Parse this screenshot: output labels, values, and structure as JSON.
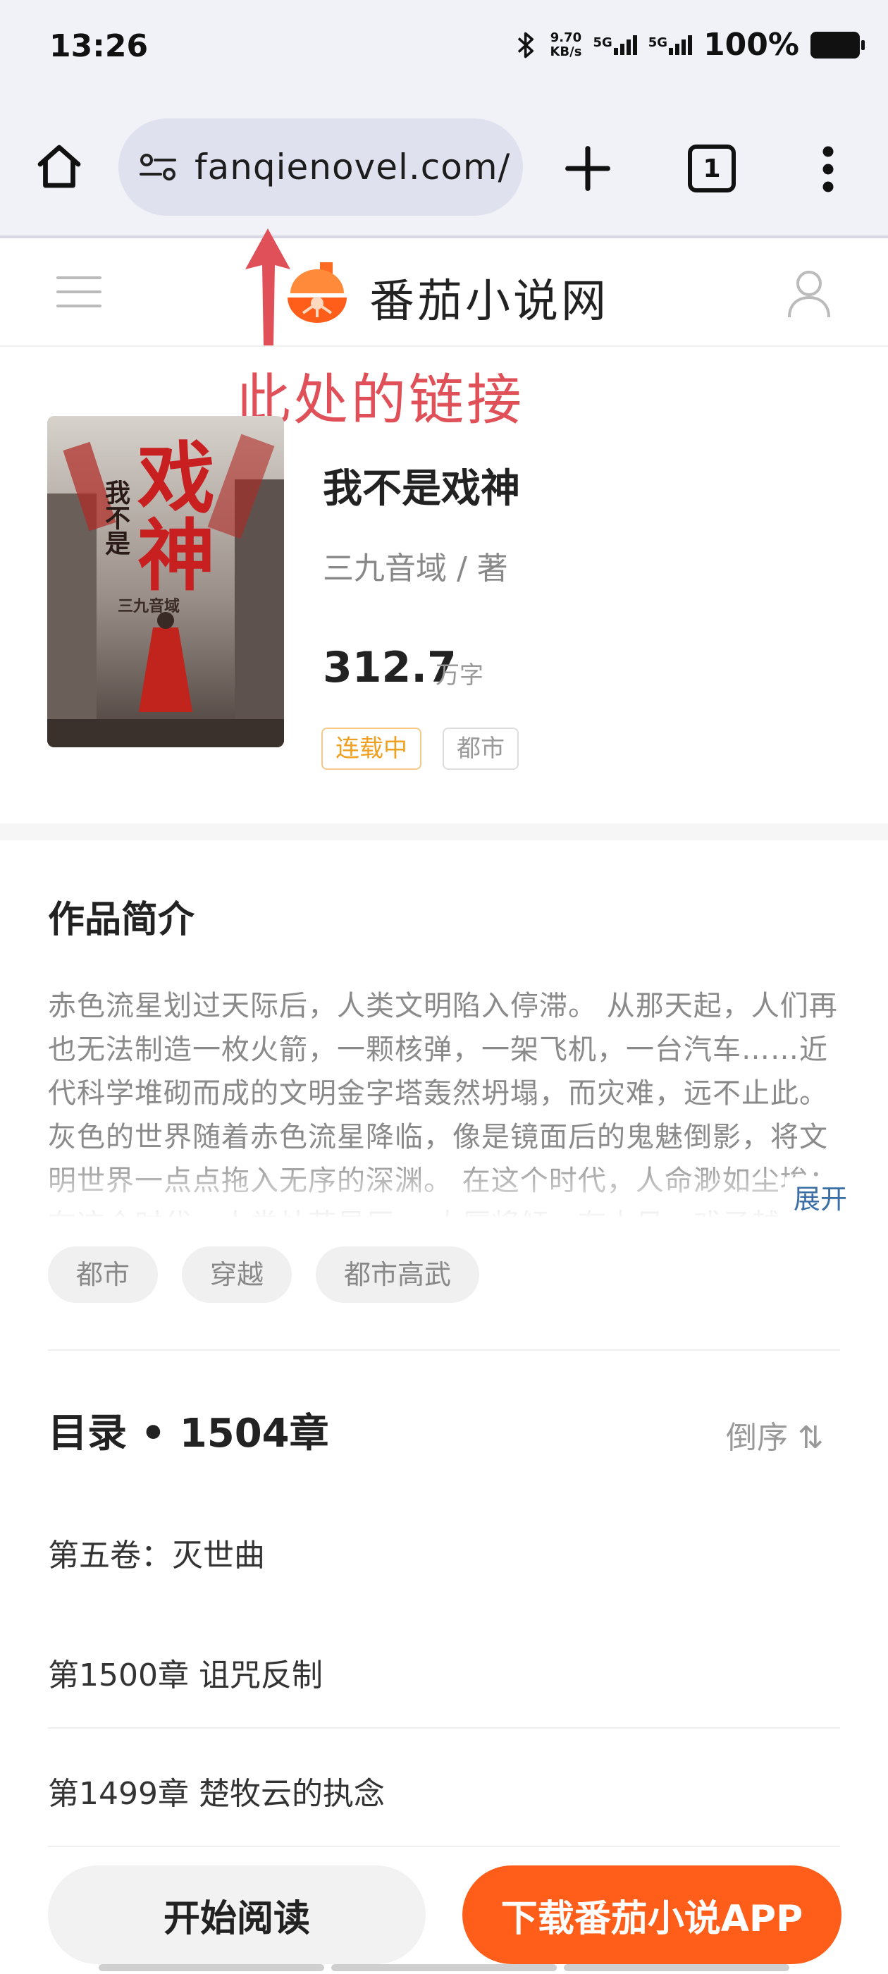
{
  "status_bar": {
    "time": "13:26",
    "speed_value": "9.70",
    "speed_unit": "KB/s",
    "net1": "5G",
    "net2": "5G",
    "battery": "100%"
  },
  "browser": {
    "url": "fanqienovel.com/",
    "tab_count": "1"
  },
  "site": {
    "name": "番茄小说网"
  },
  "annotation": {
    "text": "此处的链接"
  },
  "book": {
    "title": "我不是戏神",
    "author": "三九音域 / 著",
    "word_count": "312.7",
    "word_unit": "万字",
    "status_tag": "连载中",
    "genre_tag": "都市",
    "cover": {
      "title_small": "我不是",
      "title_large": "戏神",
      "author": "三九音域"
    }
  },
  "intro": {
    "heading": "作品简介",
    "text": "赤色流星划过天际后，人类文明陷入停滞。 从那天起，人们再也无法制造一枚火箭，一颗核弹，一架飞机，一台汽车……近代科学堆砌而成的文明金字塔轰然坍塌，而灾难，远不止此。 灰色的世界随着赤色流星降临，像是镜面后的鬼魅倒影，将文明世界一点点拖入无序的深渊。 在这个时代，人命渺如尘埃； 在这个时代，人类灿若星辰。 大厦将倾，有人见一戏子越",
    "expand_label": "展开",
    "tags": [
      "都市",
      "穿越",
      "都市高武"
    ]
  },
  "catalog": {
    "heading": "目录 • 1504章",
    "sort_label": "倒序 ⇅",
    "items": [
      "第五卷：灭世曲",
      "第1500章 诅咒反制",
      "第1499章 楚牧云的执念"
    ]
  },
  "actions": {
    "read_label": "开始阅读",
    "download_label": "下载番茄小说APP"
  },
  "colors": {
    "accent_orange": "#ff5e1a",
    "annotation_red": "#e05058",
    "status_tag": "#f0a020",
    "link_blue": "#3a6ea5"
  }
}
